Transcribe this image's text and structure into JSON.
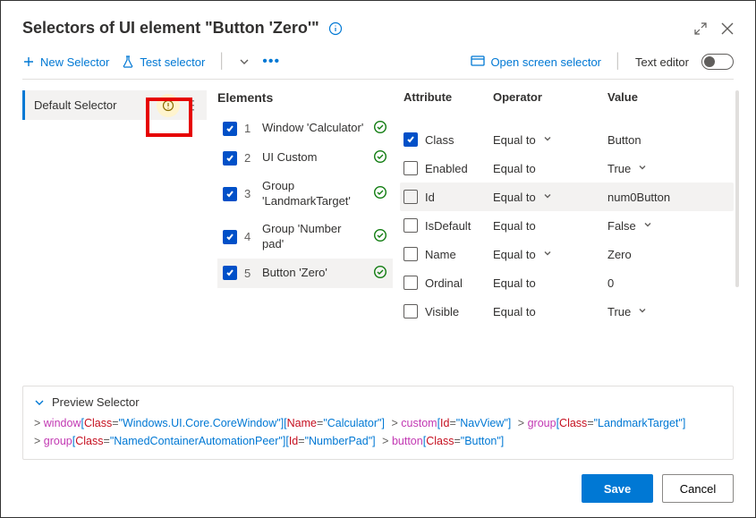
{
  "title": "Selectors of UI element \"Button 'Zero'\"",
  "toolbar": {
    "new_selector": "New Selector",
    "test_selector": "Test selector",
    "open_screen_selector": "Open screen selector",
    "text_editor": "Text editor"
  },
  "sidebar": {
    "items": [
      {
        "label": "Default Selector"
      }
    ]
  },
  "elements_heading": "Elements",
  "elements": [
    {
      "num": "1",
      "label": "Window 'Calculator'",
      "checked": true
    },
    {
      "num": "2",
      "label": "UI Custom",
      "checked": true
    },
    {
      "num": "3",
      "label": "Group 'LandmarkTarget'",
      "checked": true
    },
    {
      "num": "4",
      "label": "Group 'Number pad'",
      "checked": true
    },
    {
      "num": "5",
      "label": "Button 'Zero'",
      "checked": true,
      "selected": true
    }
  ],
  "attr_headers": {
    "attribute": "Attribute",
    "operator": "Operator",
    "value": "Value"
  },
  "attributes": [
    {
      "name": "Class",
      "checked": true,
      "operator": "Equal to",
      "op_chev": true,
      "value": "Button",
      "val_chev": false,
      "selected": false
    },
    {
      "name": "Enabled",
      "checked": false,
      "operator": "Equal to",
      "op_chev": false,
      "value": "True",
      "val_chev": true,
      "selected": false
    },
    {
      "name": "Id",
      "checked": false,
      "operator": "Equal to",
      "op_chev": true,
      "value": "num0Button",
      "val_chev": false,
      "selected": true
    },
    {
      "name": "IsDefault",
      "checked": false,
      "operator": "Equal to",
      "op_chev": false,
      "value": "False",
      "val_chev": true,
      "selected": false
    },
    {
      "name": "Name",
      "checked": false,
      "operator": "Equal to",
      "op_chev": true,
      "value": "Zero",
      "val_chev": false,
      "selected": false
    },
    {
      "name": "Ordinal",
      "checked": false,
      "operator": "Equal to",
      "op_chev": false,
      "value": "0",
      "val_chev": false,
      "selected": false
    },
    {
      "name": "Visible",
      "checked": false,
      "operator": "Equal to",
      "op_chev": false,
      "value": "True",
      "val_chev": true,
      "selected": false
    }
  ],
  "preview": {
    "title": "Preview Selector",
    "segments": [
      {
        "kw": "window",
        "pairs": [
          [
            "Class",
            "Windows.UI.Core.CoreWindow"
          ],
          [
            "Name",
            "Calculator"
          ]
        ]
      },
      {
        "kw": "custom",
        "pairs": [
          [
            "Id",
            "NavView"
          ]
        ]
      },
      {
        "kw": "group",
        "pairs": [
          [
            "Class",
            "LandmarkTarget"
          ]
        ]
      },
      {
        "kw": "group",
        "pairs": [
          [
            "Class",
            "NamedContainerAutomationPeer"
          ],
          [
            "Id",
            "NumberPad"
          ]
        ]
      },
      {
        "kw": "button",
        "pairs": [
          [
            "Class",
            "Button"
          ]
        ]
      }
    ]
  },
  "footer": {
    "save": "Save",
    "cancel": "Cancel"
  }
}
